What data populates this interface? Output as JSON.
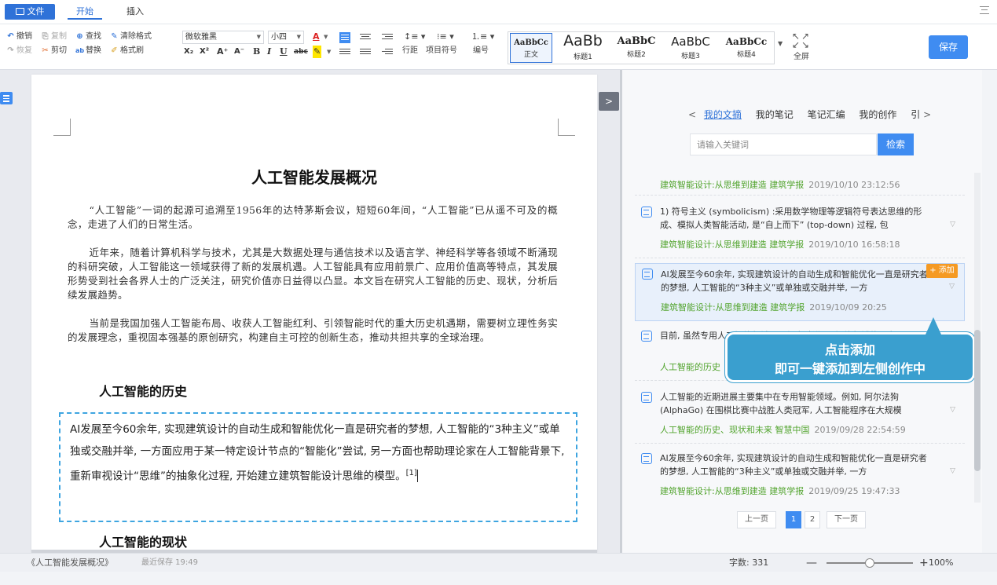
{
  "menubar": {
    "file": "文件",
    "start": "开始",
    "insert": "插入"
  },
  "ribbon": {
    "undo": "撤销",
    "redo": "恢复",
    "copy": "复制",
    "cut": "剪切",
    "find": "查找",
    "replace": "替换",
    "clear_format": "清除格式",
    "format_painter": "格式刷",
    "font_name": "微软雅黑",
    "font_size": "小四",
    "line_spacing": "行距",
    "bullets": "项目符号",
    "numbering": "编号",
    "fullscreen": "全屏",
    "save": "保存",
    "styles": [
      {
        "preview": "AaBbCc",
        "name": "正文"
      },
      {
        "preview": "AaBb",
        "name": "标题1"
      },
      {
        "preview": "AaBbC",
        "name": "标题2"
      },
      {
        "preview": "AaBbC",
        "name": "标题3"
      },
      {
        "preview": "AaBbCc",
        "name": "标题4"
      }
    ]
  },
  "document": {
    "title": "人工智能发展概况",
    "p1": "“人工智能”一词的起源可追溯至1956年的达特茅斯会议，短短60年间，“人工智能”已从遥不可及的概念，走进了人们的日常生活。",
    "p2": "近年来，随着计算机科学与技术，尤其是大数据处理与通信技术以及语言学、神经科学等各领域不断涌现的科研突破，人工智能这一领域获得了新的发展机遇。人工智能具有应用前景广、应用价值高等特点，其发展形势受到社会各界人士的广泛关注，研究价值亦日益得以凸显。本文旨在研究人工智能的历史、现状，分析后续发展趋势。",
    "p3": "当前是我国加强人工智能布局、收获人工智能红利、引领智能时代的重大历史机遇期，需要树立理性务实的发展理念，重视固本强基的原创研究，构建自主可控的创新生态，推动共担共享的全球治理。",
    "h_history": "人工智能的历史",
    "inserted": "AI发展至今60余年, 实现建筑设计的自动生成和智能优化一直是研究者的梦想, 人工智能的“3种主义”或单独或交融并举, 一方面应用于某一特定设计节点的“智能化”尝试, 另一方面也帮助理论家在人工智能背景下, 重新审视设计“思维”的抽象化过程, 开始建立建筑智能设计思维的模型。",
    "footnote": "[1]",
    "h_status": "人工智能的现状"
  },
  "panel": {
    "tab_prev": "<",
    "tabs": [
      "我的文摘",
      "我的笔记",
      "笔记汇编",
      "我的创作",
      "引"
    ],
    "tab_next": ">",
    "search_placeholder": "请输入关键词",
    "search_button": "检索",
    "items": [
      {
        "text": "",
        "source": "建筑智能设计:从思维到建造 建筑学报",
        "time": "2019/10/10 23:12:56"
      },
      {
        "text": "1) 符号主义 (symbolicism) :采用数学物理等逻辑符号表达思维的形成、模拟人类智能活动, 是“自上而下” (top-down) 过程, 包",
        "source": "建筑智能设计:从思维到建造 建筑学报",
        "time": "2019/10/10 16:58:18"
      },
      {
        "text": "AI发展至今60余年, 实现建筑设计的自动生成和智能优化一直是研究者的梦想, 人工智能的“3种主义”或单独或交融并举, 一方",
        "source": "建筑智能设计:从思维到建造 建筑学报",
        "time": "2019/10/09 20:25"
      },
      {
        "text": "目前, 虽然专用人工智能领域已取得突破进展, 智能领域的研究",
        "source": "人工智能的历史",
        "time": ""
      },
      {
        "text": "人工智能的近期进展主要集中在专用智能领域。例如, 阿尔法狗(AlphaGo) 在围棋比赛中战胜人类冠军, 人工智能程序在大规模",
        "source": "人工智能的历史、现状和未来 智慧中国",
        "time": "2019/09/28 22:54:59"
      },
      {
        "text": "AI发展至今60余年, 实现建筑设计的自动生成和智能优化一直是研究者的梦想, 人工智能的“3种主义”或单独或交融并举, 一方",
        "source": "建筑智能设计:从思维到建造 建筑学报",
        "time": "2019/09/25 19:47:33"
      }
    ],
    "add_tag": "+ 添加",
    "tooltip_line1": "点击添加",
    "tooltip_line2": "即可一键添加到左侧创作中",
    "pager": {
      "prev": "上一页",
      "p1": "1",
      "p2": "2",
      "next": "下一页"
    }
  },
  "status": {
    "doc_name": "《人工智能发展概况》",
    "save_status": "最近保存 19:49",
    "word_count": "字数: 331",
    "zoom": "100%",
    "zoom_value": 0.5
  }
}
